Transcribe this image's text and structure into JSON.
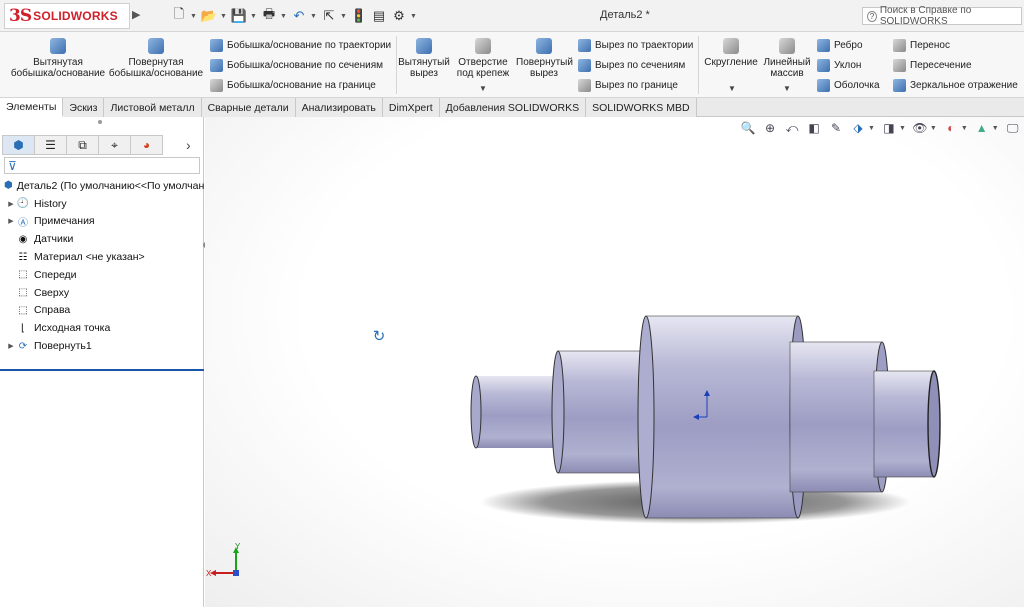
{
  "app": {
    "logo_ds": "3S",
    "logo_name": "SOLIDWORKS",
    "doc_title": "Деталь2 *",
    "help_placeholder": "Поиск в Справке по SOLIDWORKS"
  },
  "quick_access": [
    "new-document-icon",
    "open-icon",
    "save-icon",
    "print-icon",
    "undo-icon",
    "select-icon",
    "rebuild-icon",
    "file-properties-icon",
    "options-icon"
  ],
  "ribbon": {
    "extruded_boss": "Вытянутая\nбобышка/основание",
    "revolved_boss": "Повернутая\nбобышка/основание",
    "swept_boss": "Бобышка/основание по траектории",
    "lofted_boss": "Бобышка/основание по сечениям",
    "boundary_boss": "Бобышка/основание на границе",
    "extruded_cut": "Вытянутый\nвырез",
    "hole_wizard": "Отверстие\nпод крепеж",
    "revolved_cut": "Повернутый\nвырез",
    "swept_cut": "Вырез по траектории",
    "lofted_cut": "Вырез по сечениям",
    "boundary_cut": "Вырез по границе",
    "fillet": "Скругление",
    "linear_pattern": "Линейный\nмассив",
    "rib": "Ребро",
    "draft": "Уклон",
    "shell": "Оболочка",
    "wrap": "Перенос",
    "intersect": "Пересечение",
    "mirror": "Зеркальное отражение"
  },
  "tabs": [
    "Элементы",
    "Эскиз",
    "Листовой металл",
    "Сварные детали",
    "Анализировать",
    "DimXpert",
    "Добавления SOLIDWORKS",
    "SOLIDWORKS MBD"
  ],
  "tree": {
    "root": "Деталь2  (По умолчанию<<По умолчан",
    "items": [
      {
        "label": "History",
        "icon": "history-icon"
      },
      {
        "label": "Примечания",
        "icon": "annotations-icon"
      },
      {
        "label": "Датчики",
        "icon": "sensors-icon"
      },
      {
        "label": "Материал <не указан>",
        "icon": "material-icon"
      },
      {
        "label": "Спереди",
        "icon": "plane-icon"
      },
      {
        "label": "Сверху",
        "icon": "plane-icon"
      },
      {
        "label": "Справа",
        "icon": "plane-icon"
      },
      {
        "label": "Исходная точка",
        "icon": "origin-icon"
      },
      {
        "label": "Повернуть1",
        "icon": "revolve-feature-icon"
      }
    ]
  },
  "triad": {
    "x": "X",
    "y": "Y"
  }
}
